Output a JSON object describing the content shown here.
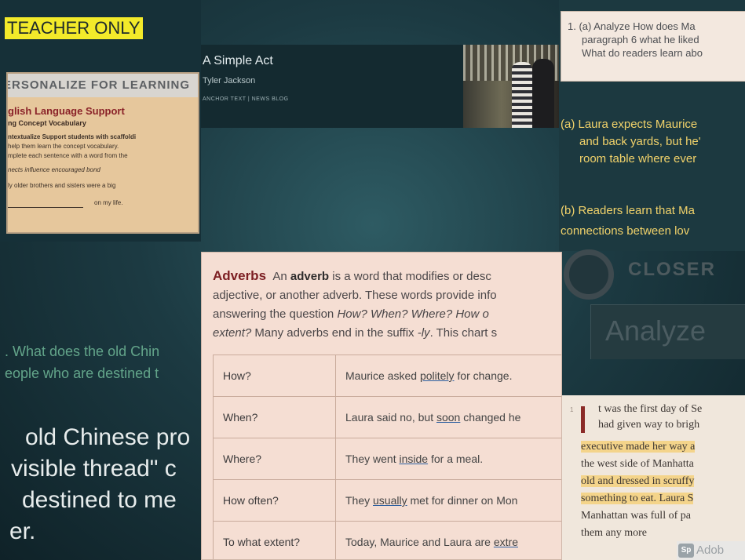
{
  "teacher": {
    "label": "TEACHER ONLY",
    "personalize": "ERSONALIZE FOR LEARNING",
    "els_title": "glish Language Support",
    "els_sub": "ng Concept Vocabulary",
    "lines": [
      "ntextualize Support students with scaffoldi",
      "help them learn the concept vocabulary.",
      "mplete each sentence with a word from the",
      "nects influence encouraged bond",
      "ly older brothers and sisters were a big",
      "on my life."
    ]
  },
  "banner": {
    "title": "A Simple Act",
    "author": "Tyler Jackson",
    "tag": "ANCHOR TEXT | NEWS BLOG"
  },
  "question": {
    "lines": [
      "1. (a) Analyze How does Ma",
      "paragraph 6 what he liked",
      "What do readers learn abo"
    ],
    "answers": [
      "(a) Laura expects Maurice",
      "and back yards, but he'",
      "room table where ever",
      "(b) Readers learn that Ma",
      "connections between lov"
    ]
  },
  "closer": {
    "heading": "CLOSER",
    "analyze": "Analyze"
  },
  "story": {
    "para_num": "1",
    "lines": [
      "t was the first day of Se",
      "had given way to brigh",
      "executive made her way a",
      "the west side of Manhatta",
      "old and dressed in scruffy",
      "something to eat. Laura S",
      "Manhattan was full of pa",
      "them any more"
    ],
    "badge_icon": "Sp",
    "badge_text": "Adob"
  },
  "proverb": {
    "question": [
      ". What does the old Chin",
      "eople who are destined t"
    ],
    "big": [
      "old Chinese pro",
      "visible thread\" c",
      "destined to me",
      "er."
    ]
  },
  "adverbs": {
    "heading": "Adverbs",
    "intro_1a": "An ",
    "intro_1b": "adverb",
    "intro_1c": " is a word that modifies or desc",
    "intro_2": "adjective, or another adverb. These words provide info",
    "intro_3a": "answering the question ",
    "intro_3b": "How? When? Where? How o",
    "intro_4a": "extent?",
    "intro_4b": " Many adverbs end in the suffix ",
    "intro_4c": "-ly",
    "intro_4d": ". This chart s",
    "rows": [
      {
        "q": "How?",
        "pre": "Maurice asked ",
        "adv": "politely",
        "post": " for change."
      },
      {
        "q": "When?",
        "pre": "Laura said no, but ",
        "adv": "soon",
        "post": " changed he"
      },
      {
        "q": "Where?",
        "pre": "They went ",
        "adv": "inside",
        "post": " for a meal."
      },
      {
        "q": "How often?",
        "pre": "They ",
        "adv": "usually",
        "post": " met for dinner on Mon"
      },
      {
        "q": "To what extent?",
        "pre": "Today, Maurice and Laura are ",
        "adv": "extre",
        "post": ""
      }
    ]
  },
  "colors": {
    "highlight": "#f3ea2a",
    "answer_text": "#f1d26a",
    "adverbs_heading": "#7c1e22",
    "proverb_question": "#63a58a"
  }
}
